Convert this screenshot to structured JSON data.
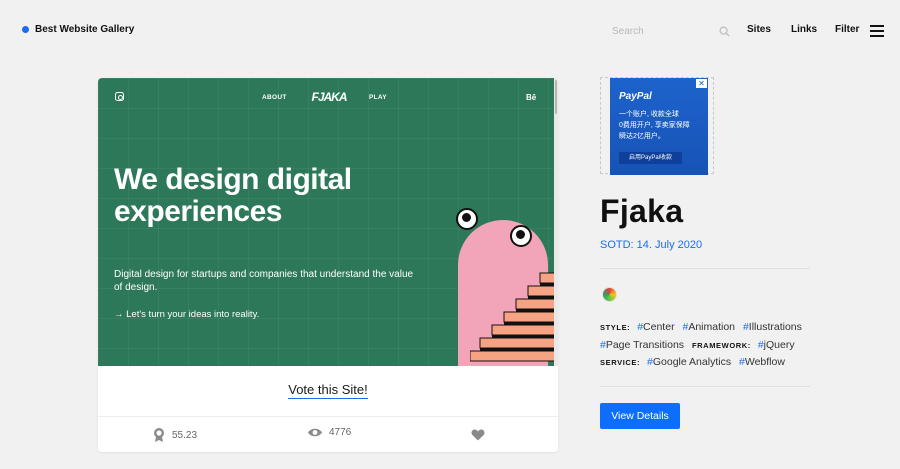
{
  "header": {
    "brand": "Best Website Gallery",
    "search_placeholder": "Search",
    "nav": [
      "Sites",
      "Links",
      "Filter"
    ]
  },
  "screenshot": {
    "nav_about": "ABOUT",
    "nav_logo": "FJAKA",
    "nav_play": "PLAY",
    "nav_behance": "Bē",
    "headline": "We design digital experiences",
    "subline": "Digital design for startups and companies that understand the value of design.",
    "cta": "→  Let's turn your ideas into reality."
  },
  "card": {
    "vote_label": "Vote this Site!",
    "score": "55.23",
    "views": "4776"
  },
  "ad": {
    "brand": "PayPal",
    "line1": "一个账户, 收款全球",
    "line2": "0费用开户, 享卖家保障",
    "line3": "瞬达2亿用户。",
    "button": "启用PayPal收款",
    "close": "✕"
  },
  "site": {
    "title": "Fjaka",
    "sotd": "SOTD: 14. July 2020",
    "style_label": "STYLE:",
    "style_tags": [
      "Center",
      "Animation",
      "Illustrations"
    ],
    "framework_label": "FRAMEWORK:",
    "framework_tags": [
      "jQuery"
    ],
    "page_tag": "Page Transitions",
    "service_label": "SERVICE:",
    "service_tags": [
      "Google Analytics",
      "Webflow"
    ],
    "details_button": "View Details"
  },
  "colors": {
    "accent": "#1a6cf0",
    "screenshot_bg": "#2c7858",
    "blob": "#f2a5b8",
    "stairs": "#f5a383"
  }
}
